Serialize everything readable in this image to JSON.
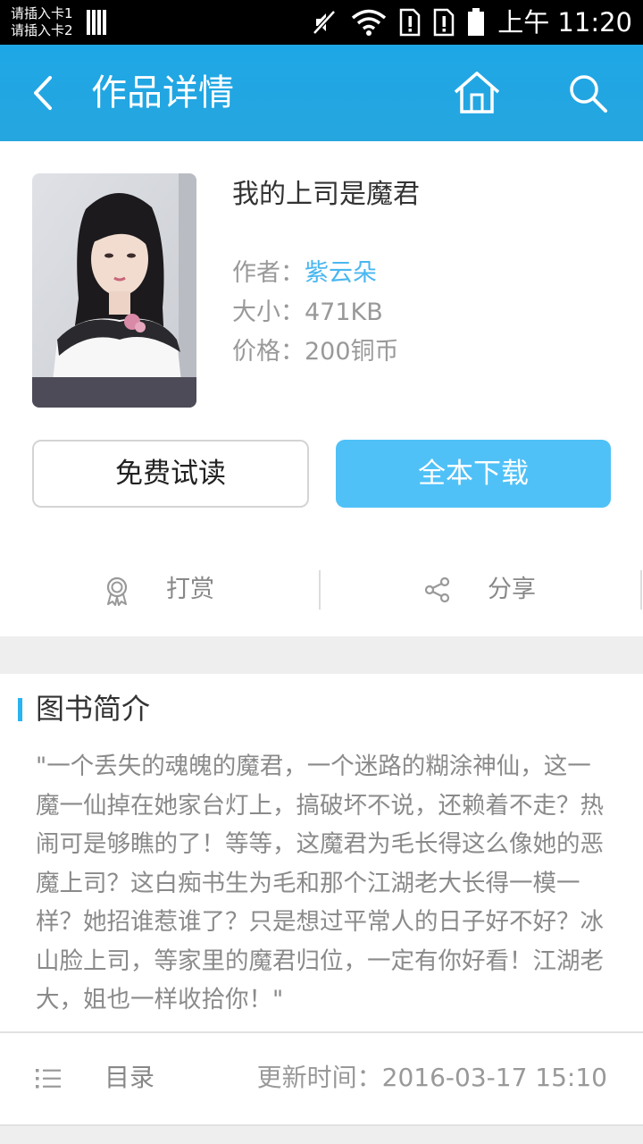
{
  "status_bar": {
    "sim1": "请插入卡1",
    "sim2": "请插入卡2",
    "time": "上午 11:20",
    "icons": [
      "signal-bars-icon",
      "mute-icon",
      "wifi-icon",
      "sim-missing-icon",
      "sim-missing-icon",
      "battery-icon"
    ]
  },
  "header": {
    "title": "作品详情",
    "back_icon": "chevron-left-icon",
    "home_icon": "home-icon",
    "search_icon": "search-icon",
    "color": "#1ea7e6"
  },
  "book": {
    "title": "我的上司是魔君",
    "author_label": "作者：",
    "author": "紫云朵",
    "size_label": "大小：",
    "size": "471KB",
    "price_label": "价格：",
    "price": "200铜币",
    "cover_icon": "book-cover-image"
  },
  "buttons": {
    "free_trial": "免费试读",
    "download_full": "全本下载",
    "accent": "#4fc1f7"
  },
  "actions": {
    "reward_label": "打赏",
    "reward_icon": "award-ribbon-icon",
    "share_label": "分享",
    "share_icon": "share-icon"
  },
  "intro": {
    "heading": "图书简介",
    "text": "\"一个丢失的魂魄的魔君，一个迷路的糊涂神仙，这一魔一仙掉在她家台灯上，搞破坏不说，还赖着不走？热闹可是够瞧的了！等等，这魔君为毛长得这么像她的恶魔上司？这白痴书生为毛和那个江湖老大长得一模一样？她招谁惹谁了？只是想过平常人的日子好不好？冰山脸上司，等家里的魔君归位，一定有你好看！江湖老大，姐也一样收拾你！\""
  },
  "catalog": {
    "label": "目录",
    "icon": "list-icon",
    "update_label": "更新时间：",
    "update_time": "2016-03-17 15:10"
  }
}
